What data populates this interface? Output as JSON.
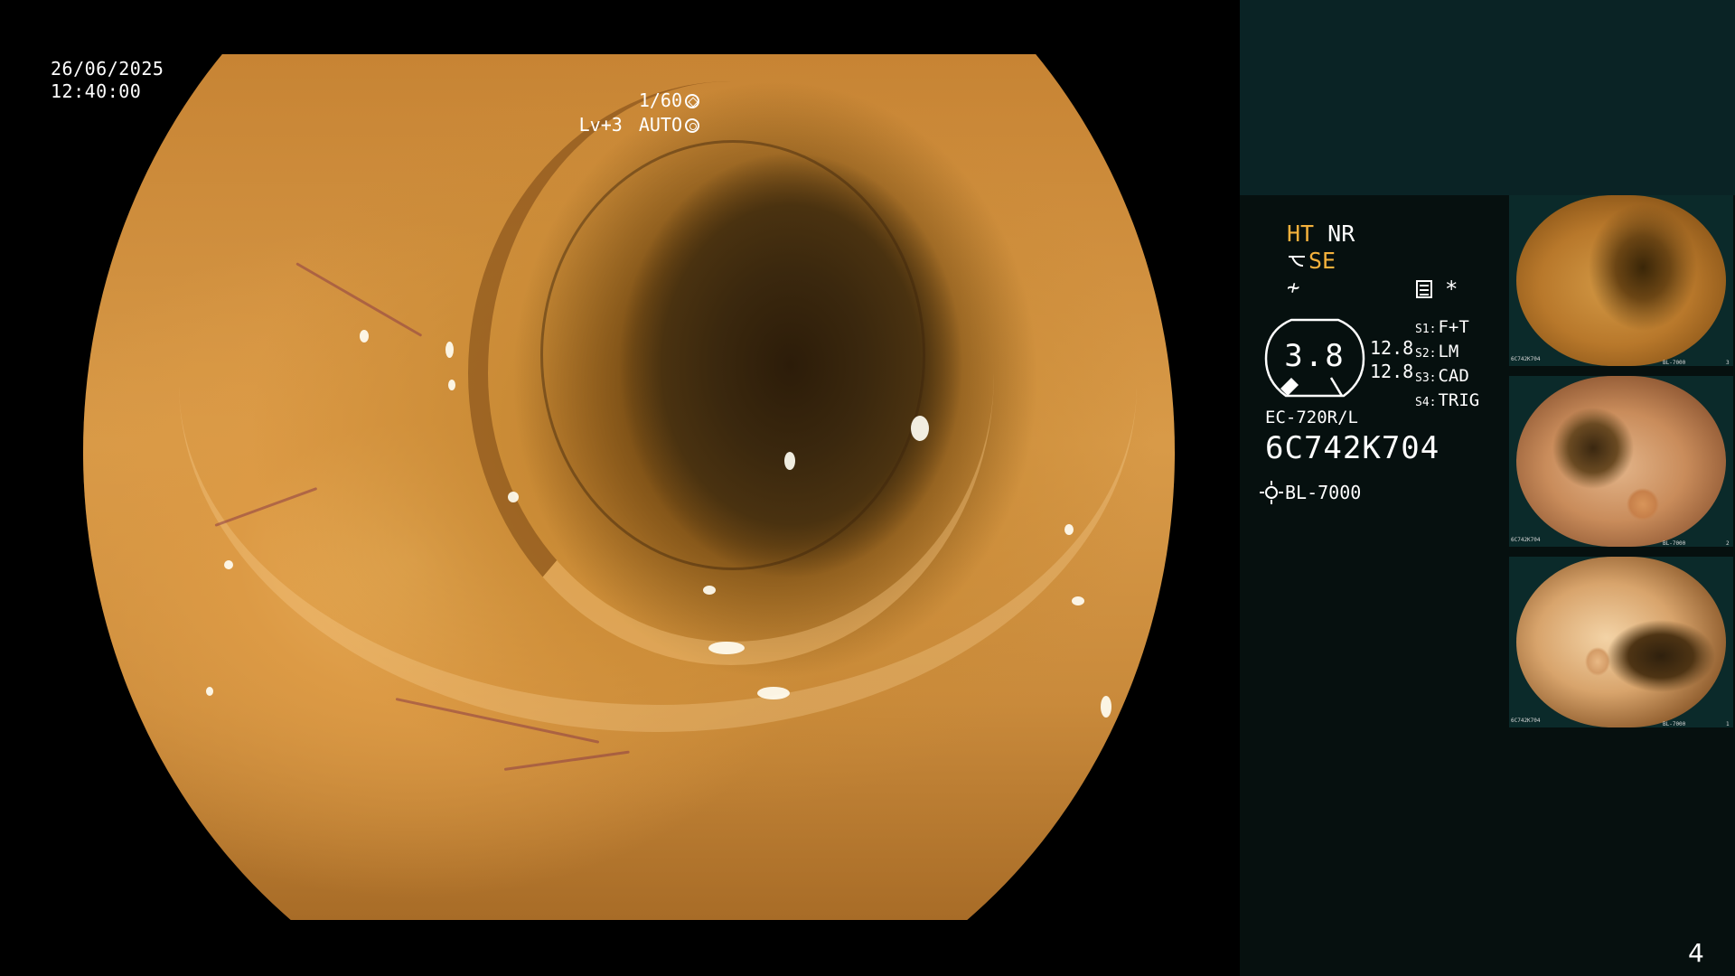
{
  "overlay": {
    "date": "26/06/2025",
    "time": "12:40:00",
    "shutter": "1/60",
    "level": "Lv+3",
    "exposure_mode": "AUTO"
  },
  "modes": {
    "ht": "HT",
    "nr": "NR",
    "se": "SE",
    "enhance_glyph": "≁",
    "freeze_star": "*"
  },
  "zoom": {
    "value": "3.8",
    "side_top": "12.8",
    "side_bottom": "12.8"
  },
  "switches": [
    {
      "key": "S1:",
      "value": "F+T"
    },
    {
      "key": "S2:",
      "value": "LM"
    },
    {
      "key": "S3:",
      "value": "CAD"
    },
    {
      "key": "S4:",
      "value": "TRIG"
    }
  ],
  "scope": {
    "model": "EC-720R/L",
    "serial": "6C742K704",
    "light_source": "BL-7000"
  },
  "thumbnails": [
    {
      "serial": "6C742K704",
      "source": "BL-7000",
      "index": "3"
    },
    {
      "serial": "6C742K704",
      "source": "BL-7000",
      "index": "2"
    },
    {
      "serial": "6C742K704",
      "source": "BL-7000",
      "index": "1"
    }
  ],
  "page_number": "4",
  "colors": {
    "amber": "#f4b13c",
    "panel_bg": "#06100f",
    "panel_top": "#0a2325"
  },
  "icons": [
    "shutter-icon",
    "auto-iris-icon",
    "enhance-icon",
    "memo-icon",
    "light-source-icon"
  ]
}
